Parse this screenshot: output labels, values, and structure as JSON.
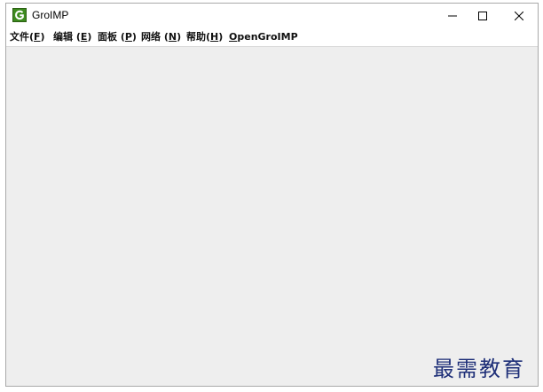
{
  "window": {
    "title": "GroIMP",
    "icon": "groimp-g-icon",
    "controls": {
      "minimize": "minimize-icon",
      "maximize": "maximize-icon",
      "close": "close-icon"
    }
  },
  "menu": {
    "items": [
      {
        "label": "文件",
        "mnemonic": "F",
        "prefix": "(",
        "suffix": ")"
      },
      {
        "label": "编辑",
        "mnemonic": "E",
        "prefix": " (",
        "suffix": ")"
      },
      {
        "label": "面板",
        "mnemonic": "P",
        "prefix": " (",
        "suffix": ")"
      },
      {
        "label": "网络",
        "mnemonic": "N",
        "prefix": " (",
        "suffix": ")"
      },
      {
        "label": "帮助",
        "mnemonic": "H",
        "prefix": "(",
        "suffix": ")"
      },
      {
        "label": "penGroIMP",
        "mnemonic": "O",
        "prefix": "",
        "suffix": ""
      }
    ]
  },
  "watermark": {
    "text": "最需教育"
  },
  "colors": {
    "content_bg": "#eeeeee",
    "icon_green": "#3d8b1f",
    "watermark": "#1e2f78"
  }
}
